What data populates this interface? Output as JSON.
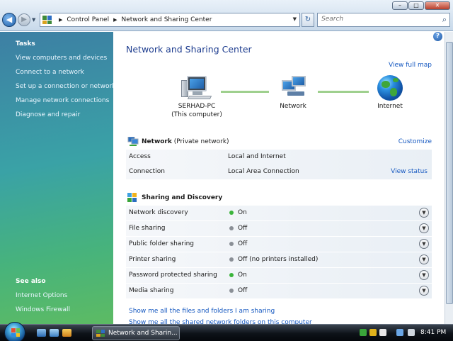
{
  "window": {
    "minimize": "–",
    "maximize": "□",
    "close": "✕"
  },
  "address": {
    "crumbs": [
      "Control Panel",
      "Network and Sharing Center"
    ],
    "search_placeholder": "Search"
  },
  "sidebar": {
    "tasks_heading": "Tasks",
    "tasks": [
      "View computers and devices",
      "Connect to a network",
      "Set up a connection or network",
      "Manage network connections",
      "Diagnose and repair"
    ],
    "see_also_heading": "See also",
    "see_also": [
      "Internet Options",
      "Windows Firewall"
    ]
  },
  "main": {
    "title": "Network and Sharing Center",
    "view_full_map": "View full map",
    "map": {
      "computer_name": "SERHAD-PC",
      "computer_sub": "(This computer)",
      "network": "Network",
      "internet": "Internet"
    },
    "network_section": {
      "name": "Network",
      "type": "(Private network)",
      "customize": "Customize",
      "rows": [
        {
          "label": "Access",
          "value": "Local and Internet",
          "link": ""
        },
        {
          "label": "Connection",
          "value": "Local Area Connection",
          "link": "View status"
        }
      ]
    },
    "sharing_section": {
      "title": "Sharing and Discovery",
      "rows": [
        {
          "label": "Network discovery",
          "status": "On",
          "on": true
        },
        {
          "label": "File sharing",
          "status": "Off",
          "on": false
        },
        {
          "label": "Public folder sharing",
          "status": "Off",
          "on": false
        },
        {
          "label": "Printer sharing",
          "status": "Off (no printers installed)",
          "on": false
        },
        {
          "label": "Password protected sharing",
          "status": "On",
          "on": true
        },
        {
          "label": "Media sharing",
          "status": "Off",
          "on": false
        }
      ]
    },
    "footer_links": [
      "Show me all the files and folders I am sharing",
      "Show me all the shared network folders on this computer"
    ]
  },
  "taskbar": {
    "task_label": "Network and Sharin...",
    "clock": "8:41 PM"
  }
}
